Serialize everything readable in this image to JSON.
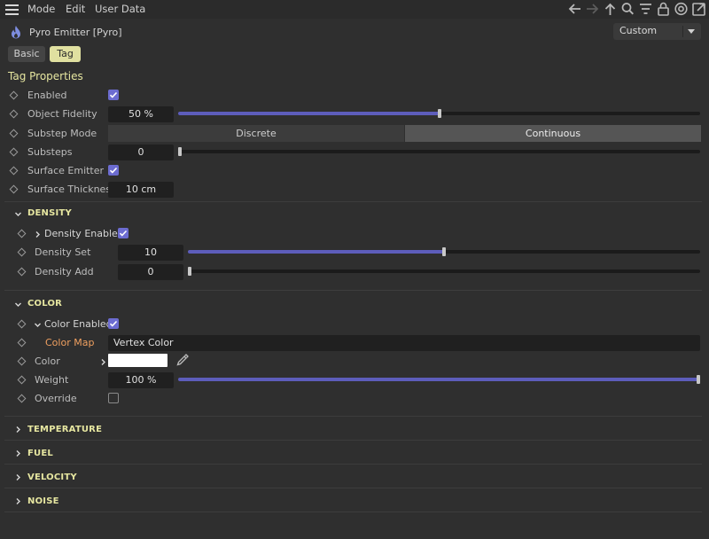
{
  "menu": {
    "items": [
      "Mode",
      "Edit",
      "User Data"
    ]
  },
  "toolbar_icons": [
    "arrow-left-icon",
    "arrow-right-icon",
    "arrow-up-icon",
    "search-icon",
    "filter-icon",
    "list-icon",
    "lock-icon",
    "target-icon",
    "new-window-icon"
  ],
  "header": {
    "title": "Pyro Emitter [Pyro]",
    "preset": "Custom"
  },
  "tabs": [
    "Basic",
    "Tag"
  ],
  "active_tab": "Tag",
  "tag_properties": {
    "heading": "Tag Properties",
    "enabled_label": "Enabled",
    "enabled": true,
    "object_fidelity_label": "Object Fidelity",
    "object_fidelity_value": "50 %",
    "object_fidelity_level": 0.5,
    "substep_mode_label": "Substep Mode",
    "substep_mode_options": [
      "Discrete",
      "Continuous"
    ],
    "substep_mode_selected": "Continuous",
    "substeps_label": "Substeps",
    "substeps_value": "0",
    "substeps_level": 0.0,
    "surface_emitter_label": "Surface Emitter",
    "surface_emitter": true,
    "surface_thickness_label": "Surface Thickness",
    "surface_thickness_value": "10 cm"
  },
  "density": {
    "title": "DENSITY",
    "enabled_label": "Density Enabled",
    "enabled": true,
    "set_label": "Density Set",
    "set_value": "10",
    "set_level": 0.5,
    "add_label": "Density Add",
    "add_value": "0",
    "add_level": 0.0
  },
  "color": {
    "title": "COLOR",
    "enabled_label": "Color Enabled",
    "enabled": true,
    "map_label": "Color Map",
    "map_value": "Vertex Color",
    "color_label": "Color",
    "color_value": "#ffffff",
    "weight_label": "Weight",
    "weight_value": "100 %",
    "weight_level": 1.0,
    "override_label": "Override",
    "override": false
  },
  "collapsed_groups": [
    "TEMPERATURE",
    "FUEL",
    "VELOCITY",
    "NOISE"
  ],
  "colors": {
    "accent": "#5d5dbb",
    "check": "#6c6cd0",
    "section": "#e6e6a0",
    "orange_label": "#f0a060",
    "background": "#2f2f2f"
  }
}
